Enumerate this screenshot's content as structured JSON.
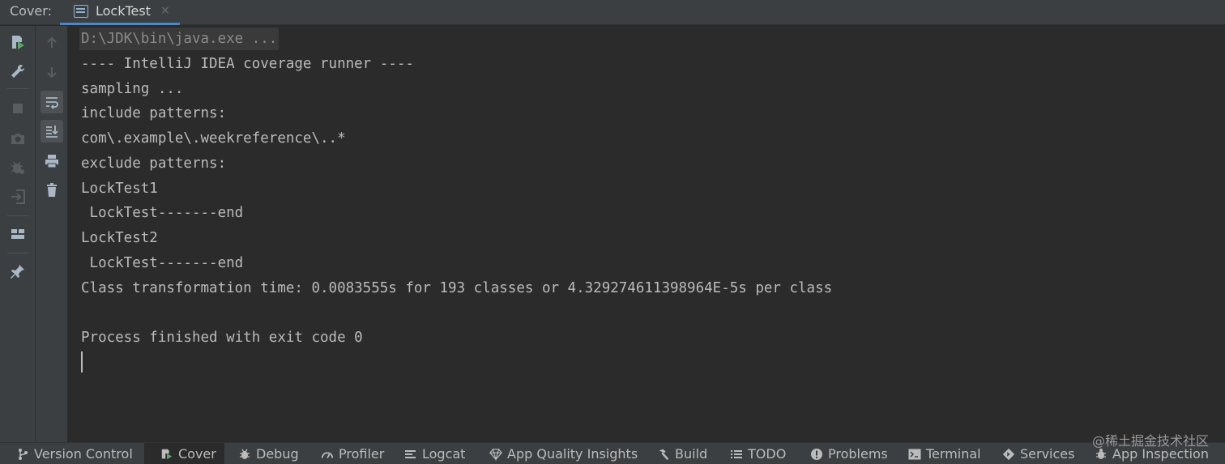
{
  "header": {
    "panel_label": "Cover:",
    "tab_title": "LockTest",
    "tab_close": "×"
  },
  "console": {
    "lines": [
      "D:\\JDK\\bin\\java.exe ...",
      "---- IntelliJ IDEA coverage runner ----",
      "sampling ...",
      "include patterns:",
      "com\\.example\\.weekreference\\..*",
      "exclude patterns:",
      "LockTest1",
      " LockTest-------end",
      "LockTest2",
      " LockTest-------end",
      "Class transformation time: 0.0083555s for 193 classes or 4.329274611398964E-5s per class",
      "",
      "Process finished with exit code 0"
    ]
  },
  "left_toolbar": {
    "icons": [
      "rerun-coverage-icon",
      "settings-wrench-icon",
      "stop-icon",
      "screenshot-camera-icon",
      "debugger-bug-icon",
      "exit-icon",
      "layout-icon",
      "pin-icon"
    ]
  },
  "console_toolbar": {
    "icons": [
      "up-arrow-icon",
      "down-arrow-icon",
      "soft-wrap-icon",
      "scroll-to-end-icon",
      "print-icon",
      "clear-trash-icon"
    ]
  },
  "bottom_bar": {
    "items": [
      {
        "label": "Version Control",
        "icon": "branch-icon"
      },
      {
        "label": "Cover",
        "icon": "coverage-icon",
        "active": true
      },
      {
        "label": "Debug",
        "icon": "bug-icon"
      },
      {
        "label": "Profiler",
        "icon": "gauge-icon"
      },
      {
        "label": "Logcat",
        "icon": "logcat-icon"
      },
      {
        "label": "App Quality Insights",
        "icon": "diamond-icon"
      },
      {
        "label": "Build",
        "icon": "hammer-icon"
      },
      {
        "label": "TODO",
        "icon": "list-icon"
      },
      {
        "label": "Problems",
        "icon": "problems-icon"
      },
      {
        "label": "Terminal",
        "icon": "terminal-icon"
      },
      {
        "label": "Services",
        "icon": "services-icon"
      },
      {
        "label": "App Inspection",
        "icon": "inspection-icon"
      }
    ],
    "watermark": "@稀土掘金技术社区"
  },
  "colors": {
    "background": "#2b2b2b",
    "panel": "#3c3f41",
    "accent": "#4a88c7",
    "text": "#bbbbbb"
  }
}
